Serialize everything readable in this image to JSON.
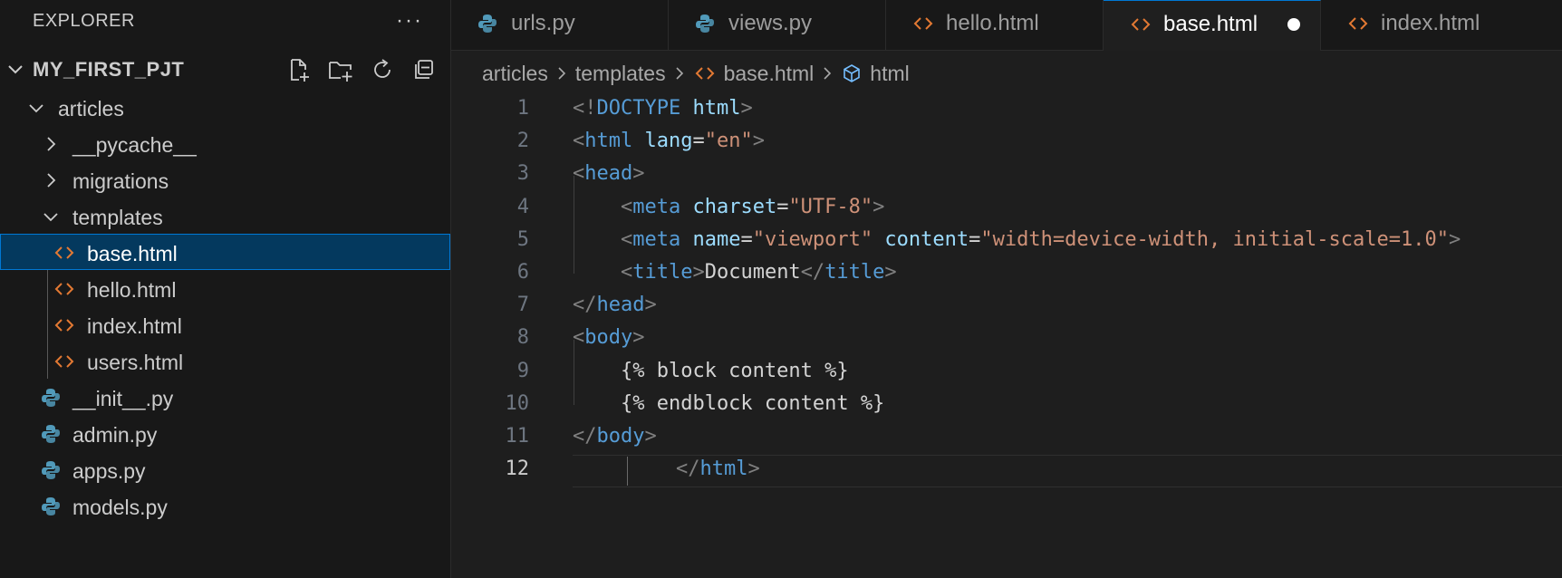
{
  "explorer": {
    "title": "EXPLORER",
    "more": "···",
    "project": "MY_FIRST_PJT",
    "tree": [
      {
        "label": "articles",
        "kind": "folder-open",
        "depth": 1
      },
      {
        "label": "__pycache__",
        "kind": "folder",
        "depth": 2
      },
      {
        "label": "migrations",
        "kind": "folder",
        "depth": 2
      },
      {
        "label": "templates",
        "kind": "folder-open",
        "depth": 2
      },
      {
        "label": "base.html",
        "kind": "html",
        "depth": 3,
        "selected": true
      },
      {
        "label": "hello.html",
        "kind": "html",
        "depth": 3
      },
      {
        "label": "index.html",
        "kind": "html",
        "depth": 3
      },
      {
        "label": "users.html",
        "kind": "html",
        "depth": 3
      },
      {
        "label": "__init__.py",
        "kind": "py",
        "depth": 2
      },
      {
        "label": "admin.py",
        "kind": "py",
        "depth": 2
      },
      {
        "label": "apps.py",
        "kind": "py",
        "depth": 2
      },
      {
        "label": "models.py",
        "kind": "py",
        "depth": 2
      }
    ]
  },
  "tabs": [
    {
      "label": "urls.py",
      "icon": "python-icon"
    },
    {
      "label": "views.py",
      "icon": "python-icon"
    },
    {
      "label": "hello.html",
      "icon": "html-icon"
    },
    {
      "label": "base.html",
      "icon": "html-icon",
      "active": true,
      "dirty": true
    },
    {
      "label": "index.html",
      "icon": "html-icon"
    }
  ],
  "breadcrumb": [
    "articles",
    "templates",
    "base.html",
    "html"
  ],
  "editor": {
    "line_numbers": [
      "1",
      "2",
      "3",
      "4",
      "5",
      "6",
      "7",
      "8",
      "9",
      "10",
      "11",
      "12"
    ],
    "lines": [
      [
        [
          "p",
          "<!"
        ],
        [
          "t",
          "DOCTYPE"
        ],
        [
          "w",
          " "
        ],
        [
          "a",
          "html"
        ],
        [
          "p",
          ">"
        ]
      ],
      [
        [
          "p",
          "<"
        ],
        [
          "t",
          "html"
        ],
        [
          "w",
          " "
        ],
        [
          "a",
          "lang"
        ],
        [
          "w",
          "="
        ],
        [
          "s",
          "\"en\""
        ],
        [
          "p",
          ">"
        ]
      ],
      [
        [
          "p",
          "<"
        ],
        [
          "t",
          "head"
        ],
        [
          "p",
          ">"
        ]
      ],
      [
        [
          "w",
          "    "
        ],
        [
          "p",
          "<"
        ],
        [
          "t",
          "meta"
        ],
        [
          "w",
          " "
        ],
        [
          "a",
          "charset"
        ],
        [
          "w",
          "="
        ],
        [
          "s",
          "\"UTF-8\""
        ],
        [
          "p",
          ">"
        ]
      ],
      [
        [
          "w",
          "    "
        ],
        [
          "p",
          "<"
        ],
        [
          "t",
          "meta"
        ],
        [
          "w",
          " "
        ],
        [
          "a",
          "name"
        ],
        [
          "w",
          "="
        ],
        [
          "s",
          "\"viewport\""
        ],
        [
          "w",
          " "
        ],
        [
          "a",
          "content"
        ],
        [
          "w",
          "="
        ],
        [
          "s",
          "\"width=device-width, initial-scale=1.0\""
        ],
        [
          "p",
          ">"
        ]
      ],
      [
        [
          "w",
          "    "
        ],
        [
          "p",
          "<"
        ],
        [
          "t",
          "title"
        ],
        [
          "p",
          ">"
        ],
        [
          "w",
          "Document"
        ],
        [
          "p",
          "</"
        ],
        [
          "t",
          "title"
        ],
        [
          "p",
          ">"
        ]
      ],
      [
        [
          "p",
          "</"
        ],
        [
          "t",
          "head"
        ],
        [
          "p",
          ">"
        ]
      ],
      [
        [
          "p",
          "<"
        ],
        [
          "t",
          "body"
        ],
        [
          "p",
          ">"
        ]
      ],
      [
        [
          "w",
          "    {% block content %}"
        ]
      ],
      [
        [
          "w",
          "    {% endblock content %}"
        ]
      ],
      [
        [
          "p",
          "</"
        ],
        [
          "t",
          "body"
        ],
        [
          "p",
          ">"
        ]
      ],
      [
        [
          "p",
          "</"
        ],
        [
          "t",
          "html"
        ],
        [
          "p",
          ">"
        ]
      ]
    ],
    "current_line": 12
  },
  "colors": {
    "accent": "#0078d4",
    "html_icon": "#e37933",
    "python_icon": "#519aba",
    "tag": "#569cd6",
    "attr": "#9cdcfe",
    "string": "#ce9178"
  }
}
